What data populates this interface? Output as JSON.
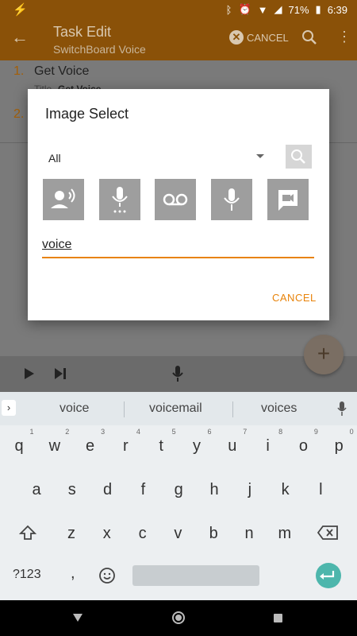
{
  "status_bar": {
    "battery": "71%",
    "time": "6:39"
  },
  "app_bar": {
    "title": "Task Edit",
    "subtitle": "SwitchBoard Voice",
    "cancel_label": "CANCEL"
  },
  "content": {
    "items": [
      {
        "number": "1.",
        "label": "Get Voice",
        "detail_key": "Title",
        "detail_value": "Get Voice"
      },
      {
        "number": "2."
      }
    ]
  },
  "dialog": {
    "title": "Image Select",
    "category_value": "All",
    "icons": [
      "speaker-voice-icon",
      "mic-dots-icon",
      "voicemail-icon",
      "mic-icon",
      "video-chat-icon"
    ],
    "search_text": "voice",
    "cancel_label": "CANCEL"
  },
  "keyboard": {
    "suggestions": [
      "voice",
      "voicemail",
      "voices"
    ],
    "row1": [
      "q",
      "w",
      "e",
      "r",
      "t",
      "y",
      "u",
      "i",
      "o",
      "p"
    ],
    "row1_hints": [
      "1",
      "2",
      "3",
      "4",
      "5",
      "6",
      "7",
      "8",
      "9",
      "0"
    ],
    "row2": [
      "a",
      "s",
      "d",
      "f",
      "g",
      "h",
      "j",
      "k",
      "l"
    ],
    "row3": [
      "z",
      "x",
      "c",
      "v",
      "b",
      "n",
      "m"
    ],
    "symbols_label": "?123",
    "comma": ","
  },
  "colors": {
    "accent": "#e8830a",
    "appbar": "#8a5108",
    "enter": "#4db6ac"
  }
}
